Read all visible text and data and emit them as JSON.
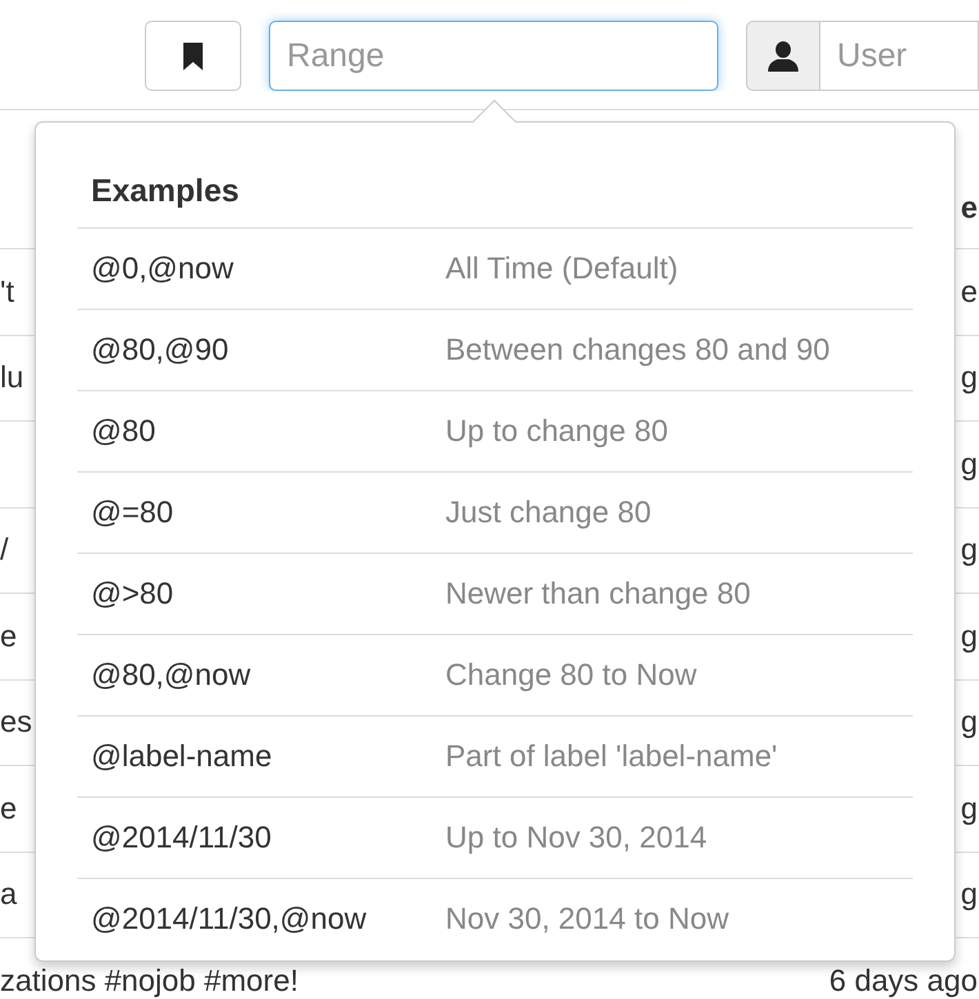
{
  "toolbar": {
    "bookmark_button": {
      "kind": "bookmark"
    },
    "range_field": {
      "placeholder": "Range",
      "focused": true
    },
    "user_field": {
      "placeholder": "User"
    }
  },
  "background_table": {
    "header": {
      "column_2": "e"
    },
    "rows": [
      {
        "column_1": "'t",
        "column_2": "e"
      },
      {
        "column_1": "lu",
        "column_2": "g"
      },
      {
        "column_2": "g"
      },
      {
        "column_1": "/",
        "column_2": "g"
      },
      {
        "column_1": "e",
        "column_2": "g"
      },
      {
        "column_1": "es",
        "column_2": "g"
      },
      {
        "column_1": "e",
        "column_2": "g"
      },
      {
        "column_1": "a",
        "column_2": "g"
      },
      {
        "column_1": "zations #nojob #more!",
        "column_2": "6 days ago"
      }
    ]
  },
  "popover": {
    "title": "Examples",
    "rows": [
      {
        "example": "@0,@now",
        "description": "All Time (Default)"
      },
      {
        "example": "@80,@90",
        "description": "Between changes 80 and 90"
      },
      {
        "example": "@80",
        "description": "Up to change 80"
      },
      {
        "example": "@=80",
        "description": "Just change 80"
      },
      {
        "example": "@>80",
        "description": "Newer than change 80"
      },
      {
        "example": "@80,@now",
        "description": "Change 80 to Now"
      },
      {
        "example": "@label-name",
        "description": "Part of label 'label-name'"
      },
      {
        "example": "@2014/11/30",
        "description": "Up to Nov 30, 2014"
      },
      {
        "example": "@2014/11/30,@now",
        "description": "Nov 30, 2014 to Now"
      }
    ]
  }
}
